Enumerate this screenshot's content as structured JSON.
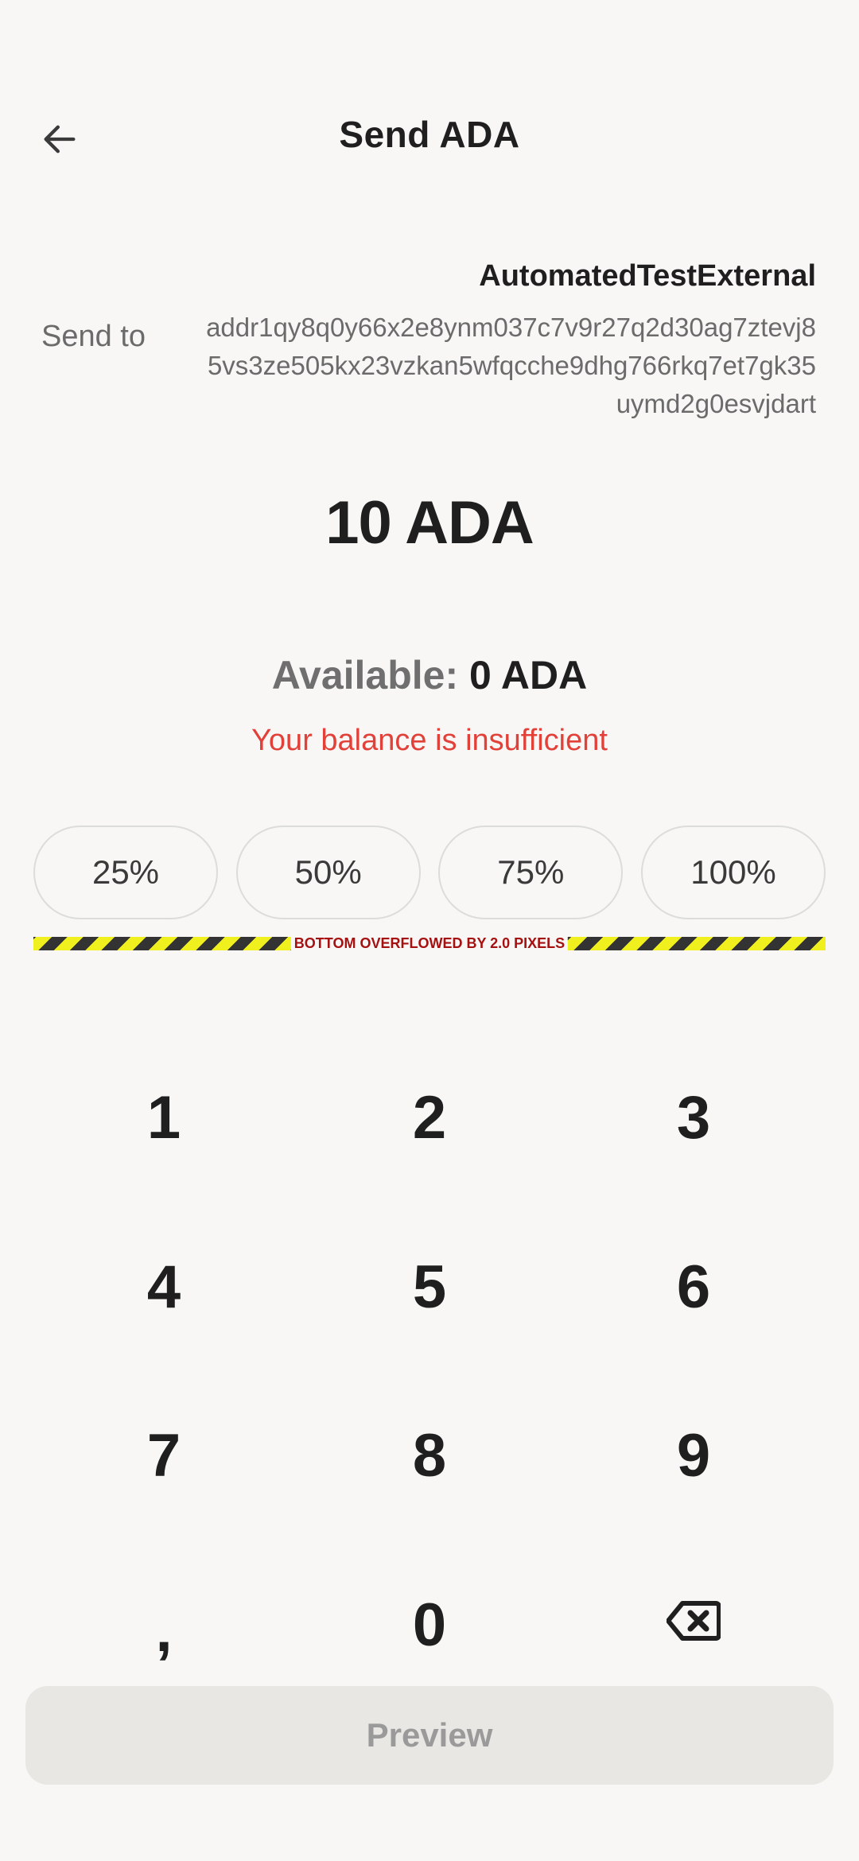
{
  "header": {
    "title": "Send ADA",
    "back_icon": "arrow-left-icon"
  },
  "recipient": {
    "name": "AutomatedTestExternal",
    "send_to_label": "Send to",
    "address_lines": [
      "addr1qy8q0y66x2e8ynm037c7v9r27q2d30ag7ztevj8",
      "5vs3ze505kx23vzkan5wfqcche9dhg766rkq7et7gk35",
      "uymd2g0esvjdart"
    ]
  },
  "amount": {
    "display": "10 ADA"
  },
  "balance": {
    "available_label": "Available:",
    "available_value": "0 ADA",
    "error": "Your balance is insufficient",
    "error_color": "#e2413a"
  },
  "percent_buttons": [
    "25%",
    "50%",
    "75%",
    "100%"
  ],
  "overflow_warning": "BOTTOM OVERFLOWED BY 2.0 PIXELS",
  "keypad": {
    "keys": [
      "1",
      "2",
      "3",
      "4",
      "5",
      "6",
      "7",
      "8",
      "9",
      ",",
      "0"
    ],
    "backspace_icon": "backspace-icon"
  },
  "footer": {
    "preview_label": "Preview"
  }
}
